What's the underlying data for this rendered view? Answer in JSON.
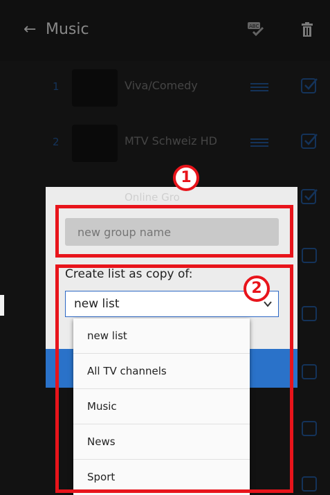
{
  "header": {
    "title": "Music",
    "back_icon": "arrow-left-icon",
    "spell_icon": "spell-check-icon",
    "delete_icon": "trash-icon"
  },
  "rows": [
    {
      "index": "1",
      "name": "Viva/Comedy",
      "checked": true
    },
    {
      "index": "2",
      "name": "MTV Schweiz HD",
      "checked": true
    }
  ],
  "dialog": {
    "ghost_title": "Online Gro",
    "group_name_placeholder": "new group name",
    "copy_label": "Create list as copy of:",
    "selected": "new list",
    "options": [
      "new list",
      "All TV channels",
      "Music",
      "News",
      "Sport"
    ]
  },
  "annotations": [
    "1",
    "2"
  ],
  "colors": {
    "accent": "#2a72c9",
    "annotation": "#e8141b",
    "background": "#1c1c1c"
  }
}
